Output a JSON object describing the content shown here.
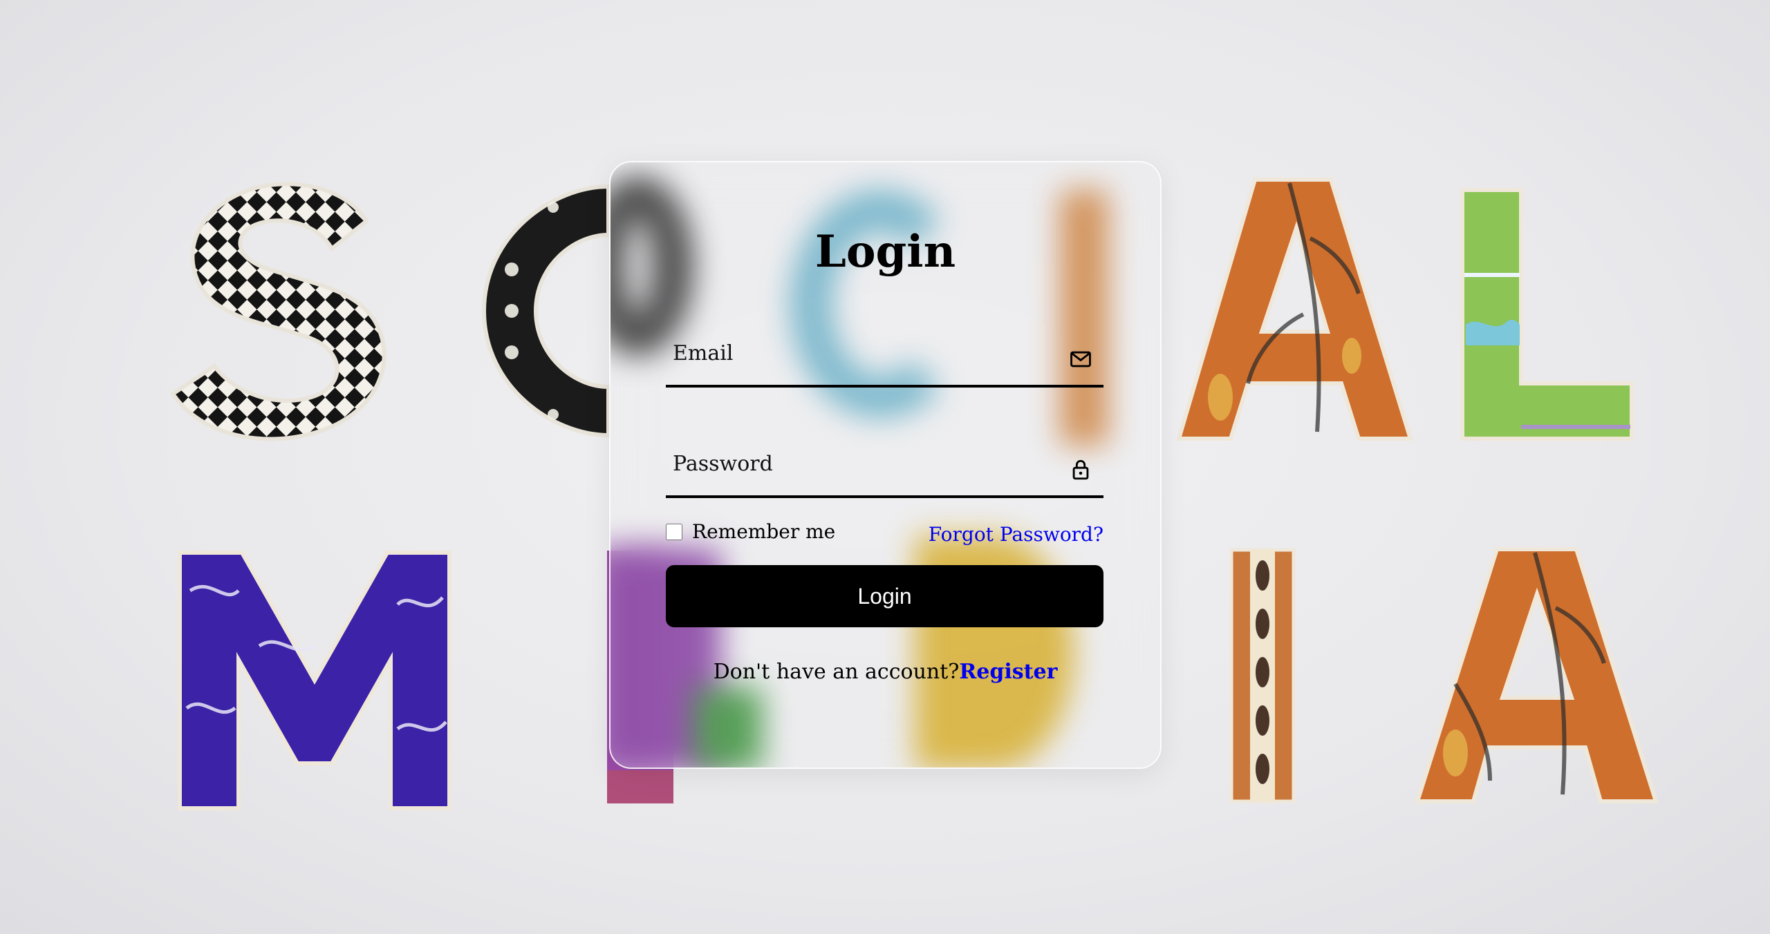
{
  "background": {
    "letters_top": [
      "S",
      "O",
      "C",
      "I",
      "A",
      "L"
    ],
    "letters_bottom": [
      "M",
      "E",
      "D",
      "I",
      "A"
    ]
  },
  "login": {
    "title": "Login",
    "email_placeholder": "Email",
    "password_placeholder": "Password",
    "remember_label": "Remember me",
    "forgot_label": "Forgot Password?",
    "button_label": "Login",
    "register_prompt": "Don't have an account?",
    "register_label": "Register"
  },
  "icons": {
    "email": "mail-icon",
    "password": "lock-icon"
  },
  "colors": {
    "link": "#0000ee",
    "button_bg": "#000000",
    "button_text": "#ffffff"
  }
}
